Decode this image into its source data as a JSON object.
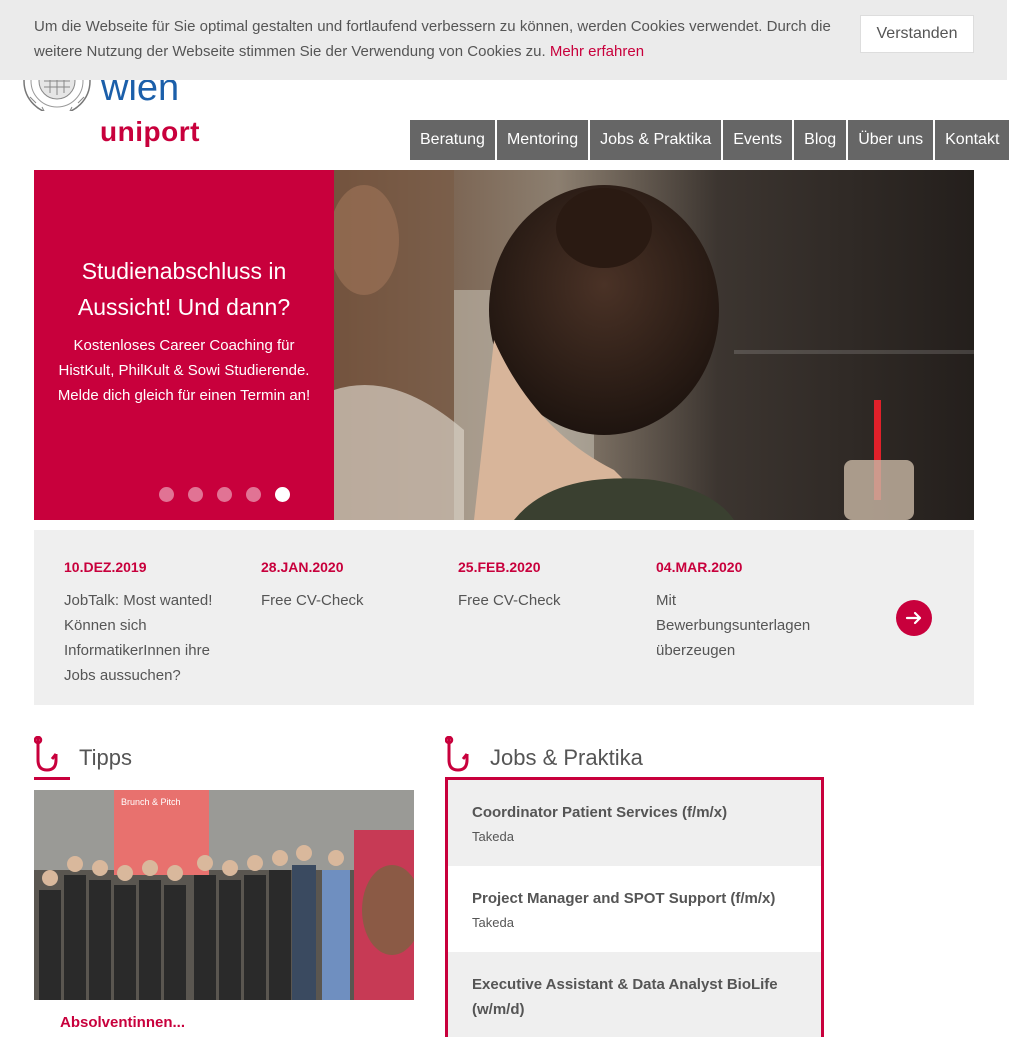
{
  "cookie": {
    "text": "Um die Webseite für Sie optimal gestalten und fortlaufend verbessern zu können, werden Cookies verwendet. Durch die weitere Nutzung der Webseite stimmen Sie der Verwendung von Cookies zu.",
    "link": "Mehr erfahren",
    "button": "Verstanden"
  },
  "logo": {
    "wien": "wien",
    "uniport": "uniport"
  },
  "nav": [
    "Beratung",
    "Mentoring",
    "Jobs & Praktika",
    "Events",
    "Blog",
    "Über uns",
    "Kontakt"
  ],
  "hero": {
    "title": "Studienabschluss in Aussicht! Und dann?",
    "body": "Kostenloses Career Coaching für HistKult, PhilKult & Sowi Studierende. Melde dich gleich für einen Termin an!",
    "slide_count": 5,
    "active_slide": 5
  },
  "events": [
    {
      "date": "10.DEZ.2019",
      "title": "JobTalk: Most wanted! Können sich InformatikerInnen ihre Jobs aussuchen?"
    },
    {
      "date": "28.JAN.2020",
      "title": "Free CV-Check"
    },
    {
      "date": "25.FEB.2020",
      "title": "Free CV-Check"
    },
    {
      "date": "04.MAR.2020",
      "title": "Mit Bewerbungsunterlagen überzeugen"
    }
  ],
  "tipps": {
    "title": "Tipps",
    "image_text": "Brunch & Pitch",
    "caption": "Absolventinnen..."
  },
  "jobs": {
    "title": "Jobs & Praktika",
    "items": [
      {
        "title": "Coordinator Patient Services (f/m/x)",
        "company": "Takeda"
      },
      {
        "title": "Project Manager and SPOT Support (f/m/x)",
        "company": "Takeda"
      },
      {
        "title": "Executive Assistant & Data Analyst BioLife (w/m/d)",
        "company": ""
      }
    ]
  },
  "colors": {
    "accent": "#c8003c",
    "nav_bg": "#666666",
    "panel_bg": "#efefef",
    "logo_blue": "#1b5faa"
  }
}
